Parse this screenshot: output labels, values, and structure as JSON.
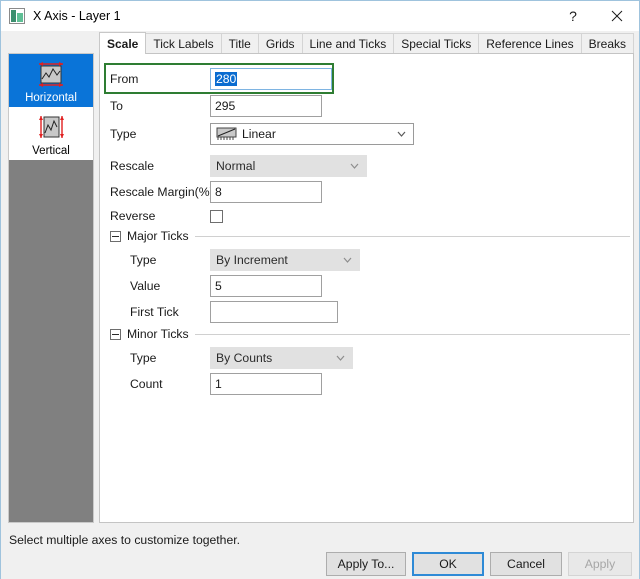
{
  "window": {
    "title": "X Axis - Layer 1",
    "icon": "axis-graph-icon",
    "help_label": "?",
    "close_label": "✕"
  },
  "tabs": [
    {
      "label": "Scale",
      "active": true
    },
    {
      "label": "Tick Labels",
      "active": false
    },
    {
      "label": "Title",
      "active": false
    },
    {
      "label": "Grids",
      "active": false
    },
    {
      "label": "Line and Ticks",
      "active": false
    },
    {
      "label": "Special Ticks",
      "active": false
    },
    {
      "label": "Reference Lines",
      "active": false
    },
    {
      "label": "Breaks",
      "active": false
    }
  ],
  "sidebar": {
    "items": [
      {
        "label": "Horizontal",
        "icon": "horizontal-axis-icon",
        "selected": true
      },
      {
        "label": "Vertical",
        "icon": "vertical-axis-icon",
        "selected": false
      }
    ]
  },
  "scale": {
    "from": {
      "label": "From",
      "value": "280",
      "selected": true
    },
    "to": {
      "label": "To",
      "value": "295"
    },
    "type": {
      "label": "Type",
      "value": "Linear",
      "icon": "linear-scale-icon"
    },
    "rescale": {
      "label": "Rescale",
      "value": "Normal"
    },
    "rescale_margin": {
      "label": "Rescale Margin(%)",
      "value": "8"
    },
    "reverse": {
      "label": "Reverse",
      "checked": false
    },
    "major_ticks": {
      "label": "Major Ticks",
      "type": {
        "label": "Type",
        "value": "By Increment"
      },
      "value": {
        "label": "Value",
        "value": "5"
      },
      "first_tick": {
        "label": "First Tick",
        "value": ""
      }
    },
    "minor_ticks": {
      "label": "Minor Ticks",
      "type": {
        "label": "Type",
        "value": "By Counts"
      },
      "count": {
        "label": "Count",
        "value": "1"
      }
    }
  },
  "status": {
    "text": "Select multiple axes to customize together."
  },
  "buttons": {
    "apply_to": "Apply To...",
    "ok": "OK",
    "cancel": "Cancel",
    "apply": "Apply"
  },
  "colors": {
    "selection_blue": "#0a74d8",
    "highlight_green": "#2e7d32",
    "focus_blue": "#2e8ad6",
    "sidebar_gray": "#808080"
  }
}
